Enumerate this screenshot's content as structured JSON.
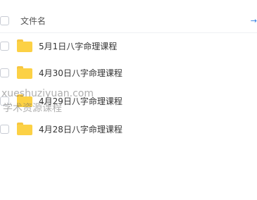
{
  "header": {
    "column_label": "文件名",
    "sort_arrow_icon": "arrow-right-icon"
  },
  "files": [
    {
      "name": "5月1日八字命理课程",
      "icon": "folder-icon"
    },
    {
      "name": "4月30日八字命理课程",
      "icon": "folder-icon"
    },
    {
      "name": "4月29日八字命理课程",
      "icon": "folder-icon"
    },
    {
      "name": "4月28日八字命理课程",
      "icon": "folder-icon"
    }
  ],
  "watermark": {
    "line1": "xueshuziyuan.com",
    "line2": "学术资源课程"
  },
  "colors": {
    "folder": "#fcd145",
    "accent": "#2f7de1",
    "divider": "#eef0f4"
  }
}
